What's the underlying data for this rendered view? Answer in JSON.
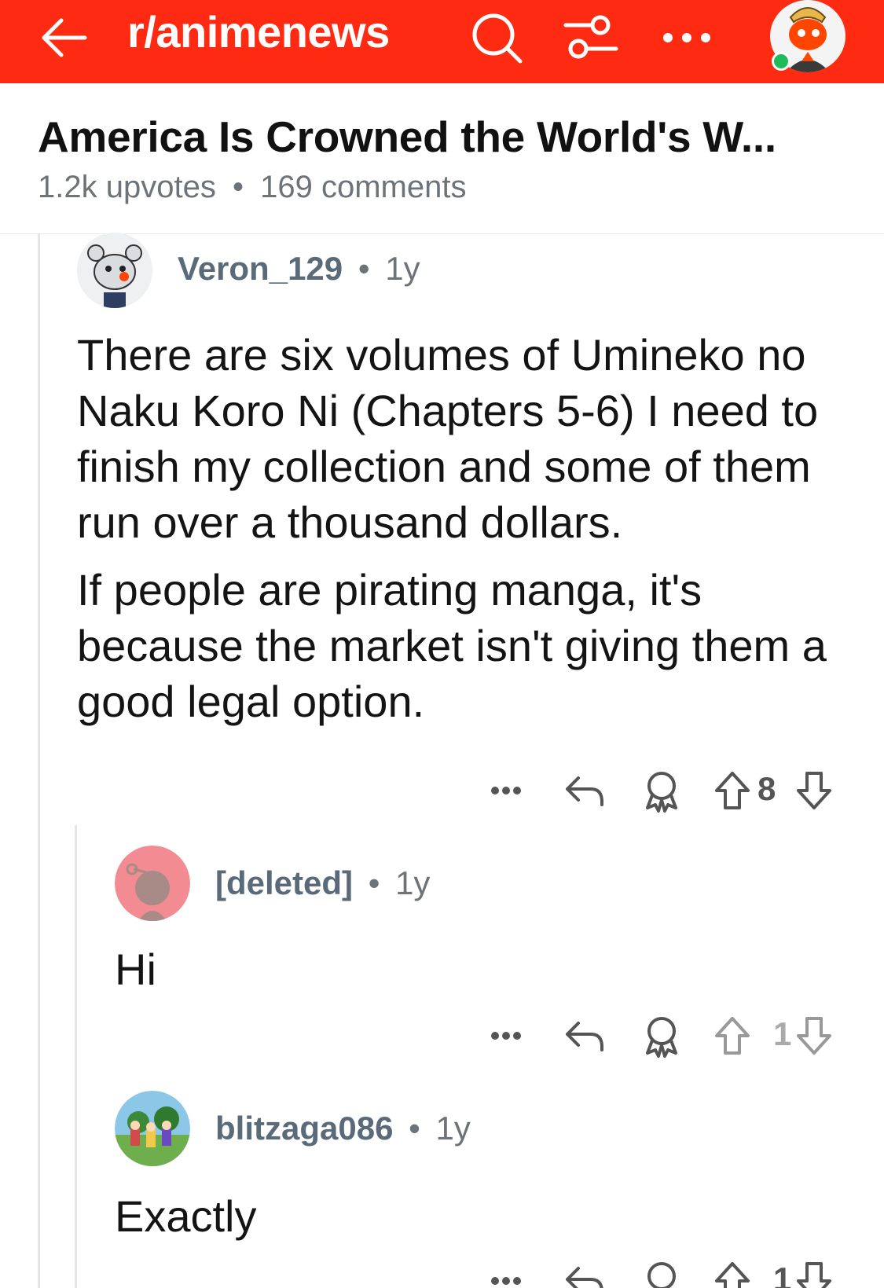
{
  "topbar": {
    "subreddit": "r/animenews",
    "bg_color": "#ff2a12",
    "icons": [
      "back-arrow-icon",
      "search-icon",
      "filter-icon",
      "more-icon",
      "user-avatar"
    ]
  },
  "post": {
    "title": "America Is Crowned the World's W...",
    "upvotes": "1.2k upvotes",
    "separator": "•",
    "comments": "169 comments"
  },
  "comments": [
    {
      "username": "Veron_129",
      "age": "1y",
      "paragraphs": [
        "There are six volumes of Umineko no Naku Koro Ni (Chapters 5-6) I need to finish my collection and some of them run over a thousand dollars.",
        "If people are pirating manga, it's because the market isn't giving them a good legal option."
      ],
      "score": "8"
    },
    {
      "username": "[deleted]",
      "age": "1y",
      "text": "Hi",
      "score": "1"
    },
    {
      "username": "blitzaga086",
      "age": "1y",
      "text": "Exactly",
      "score": "1"
    }
  ],
  "separator": "•"
}
